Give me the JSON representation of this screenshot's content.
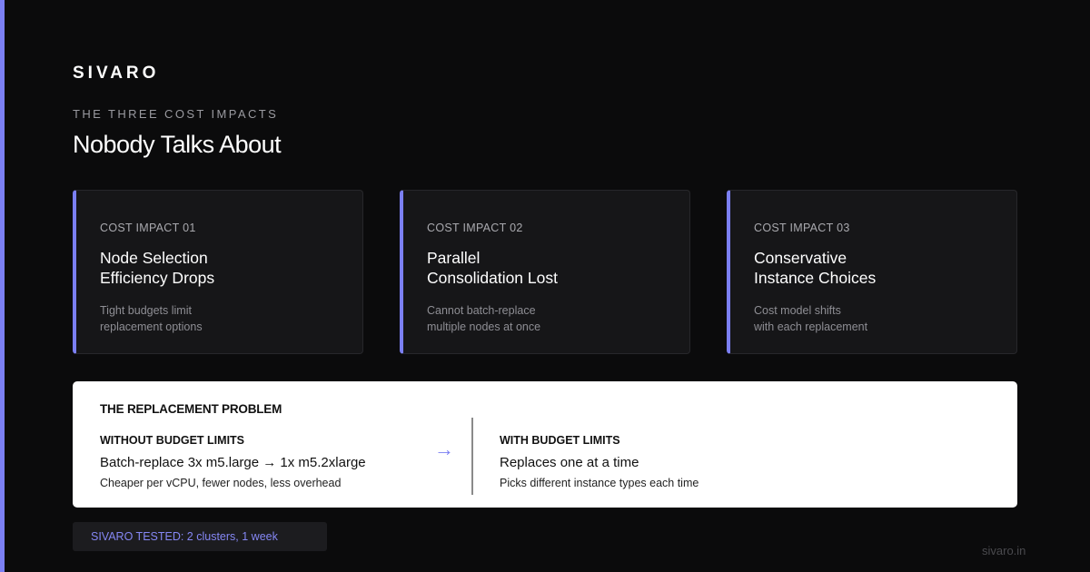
{
  "brand": "SIVARO",
  "eyebrow": "THE THREE COST IMPACTS",
  "headline": "Nobody Talks About",
  "colors": {
    "accent": "#7b7ff3",
    "background": "#0b0b0c",
    "card": "#161618"
  },
  "cards": [
    {
      "eyebrow": "COST IMPACT 01",
      "title_line1": "Node Selection",
      "title_line2": "Efficiency Drops",
      "desc_line1": "Tight budgets limit",
      "desc_line2": "replacement options"
    },
    {
      "eyebrow": "COST IMPACT 02",
      "title_line1": "Parallel",
      "title_line2": "Consolidation Lost",
      "desc_line1": "Cannot batch-replace",
      "desc_line2": "multiple nodes at once"
    },
    {
      "eyebrow": "COST IMPACT 03",
      "title_line1": "Conservative",
      "title_line2": "Instance Choices",
      "desc_line1": "Cost model shifts",
      "desc_line2": "with each replacement"
    }
  ],
  "panel": {
    "title": "THE REPLACEMENT PROBLEM",
    "arrow": "→",
    "without": {
      "label": "WITHOUT BUDGET LIMITS",
      "main": "Batch-replace 3x m5.large → 1x m5.2xlarge",
      "sub": "Cheaper per vCPU, fewer nodes, less overhead"
    },
    "with": {
      "label": "WITH BUDGET LIMITS",
      "main": "Replaces one at a time",
      "sub": "Picks different instance types each time"
    }
  },
  "tested": "SIVARO TESTED: 2 clusters, 1 week",
  "domain": "sivaro.in"
}
